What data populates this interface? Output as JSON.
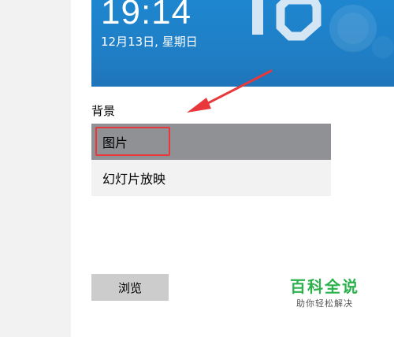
{
  "preview": {
    "time": "19:14",
    "date": "12月13日, 星期日"
  },
  "background_section": {
    "label": "背景",
    "options": [
      {
        "label": "图片",
        "selected": true
      },
      {
        "label": "幻灯片放映",
        "selected": false
      }
    ]
  },
  "browse_button_label": "浏览",
  "watermark": {
    "title": "百科全说",
    "subtitle": "助你轻松解决"
  },
  "colors": {
    "preview_blue": "#1f7fc6",
    "selected_option_bg": "#8f9194",
    "option_bg": "#f2f2f2",
    "annotation_red": "#e8383b",
    "watermark_green": "#2bb24c"
  }
}
